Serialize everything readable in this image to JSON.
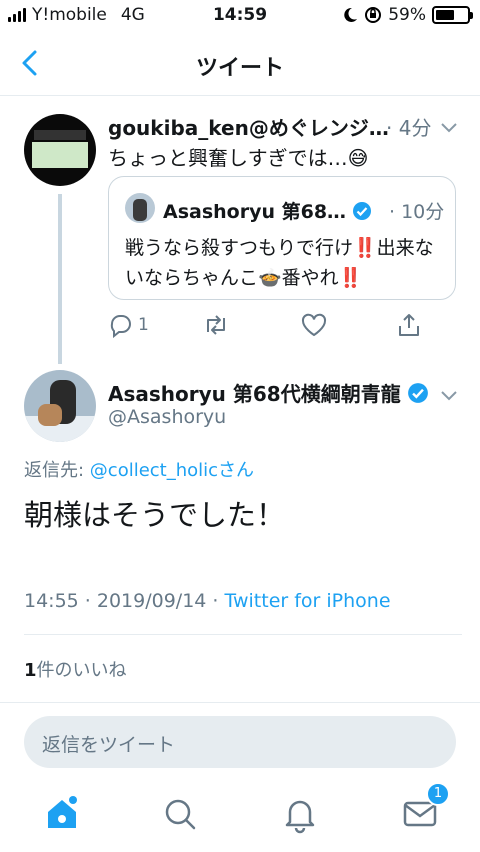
{
  "status_bar": {
    "carrier": "Y!mobile",
    "network": "4G",
    "time": "14:59",
    "battery": "59%",
    "battery_level": 0.59
  },
  "nav": {
    "title": "ツイート"
  },
  "parent_tweet": {
    "name": "goukiba_ken@めぐレンジ…",
    "time": "· 4分",
    "text": "ちょっと興奮しすぎでは…😅",
    "quote": {
      "name": "Asashoryu 第68…",
      "time": "· 10分",
      "text": "戦うなら殺すつもりで行け‼️出来ないならちゃんこ🍲番やれ‼️"
    },
    "reply_count": "1"
  },
  "main_tweet": {
    "name": "Asashoryu 第68代横綱朝青龍",
    "handle": "@Asashoryu",
    "reply_label": "返信先: ",
    "reply_to": "@collect_holicさん",
    "text": "朝様はそうでした！",
    "timestamp": "14:55 · 2019/09/14 · ",
    "source": "Twitter for iPhone",
    "likes_count": "1",
    "likes_label": "件のいいね"
  },
  "composer": {
    "placeholder": "返信をツイート"
  },
  "tabbar": {
    "messages_badge": "1"
  },
  "colors": {
    "accent": "#1da1f2",
    "muted": "#657786"
  }
}
